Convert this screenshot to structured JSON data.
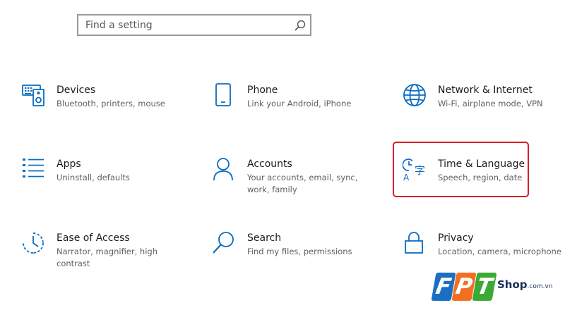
{
  "search": {
    "placeholder": "Find a setting"
  },
  "tiles": [
    {
      "title": "Devices",
      "desc": "Bluetooth, printers, mouse",
      "icon": "keyboard-speaker-icon"
    },
    {
      "title": "Phone",
      "desc": "Link your Android, iPhone",
      "icon": "phone-icon"
    },
    {
      "title": "Network & Internet",
      "desc": "Wi-Fi, airplane mode, VPN",
      "icon": "globe-icon"
    },
    {
      "title": "Apps",
      "desc": "Uninstall, defaults",
      "icon": "list-icon"
    },
    {
      "title": "Accounts",
      "desc": "Your accounts, email, sync, work, family",
      "icon": "person-icon"
    },
    {
      "title": "Time & Language",
      "desc": "Speech, region, date",
      "icon": "time-language-icon"
    },
    {
      "title": "Ease of Access",
      "desc": "Narrator, magnifier, high contrast",
      "icon": "ease-of-access-icon"
    },
    {
      "title": "Search",
      "desc": "Find my files, permissions",
      "icon": "magnifier-icon"
    },
    {
      "title": "Privacy",
      "desc": "Location, camera, microphone",
      "icon": "lock-icon"
    }
  ],
  "logo": {
    "letters": [
      "F",
      "P",
      "T"
    ],
    "shop": "Shop",
    "domain": ".com.vn"
  },
  "colors": {
    "accent": "#0a6cc2",
    "highlight": "#d81e28",
    "logo_blue": "#1b6fc2",
    "logo_orange": "#f26f21",
    "logo_green": "#3aaa35"
  }
}
